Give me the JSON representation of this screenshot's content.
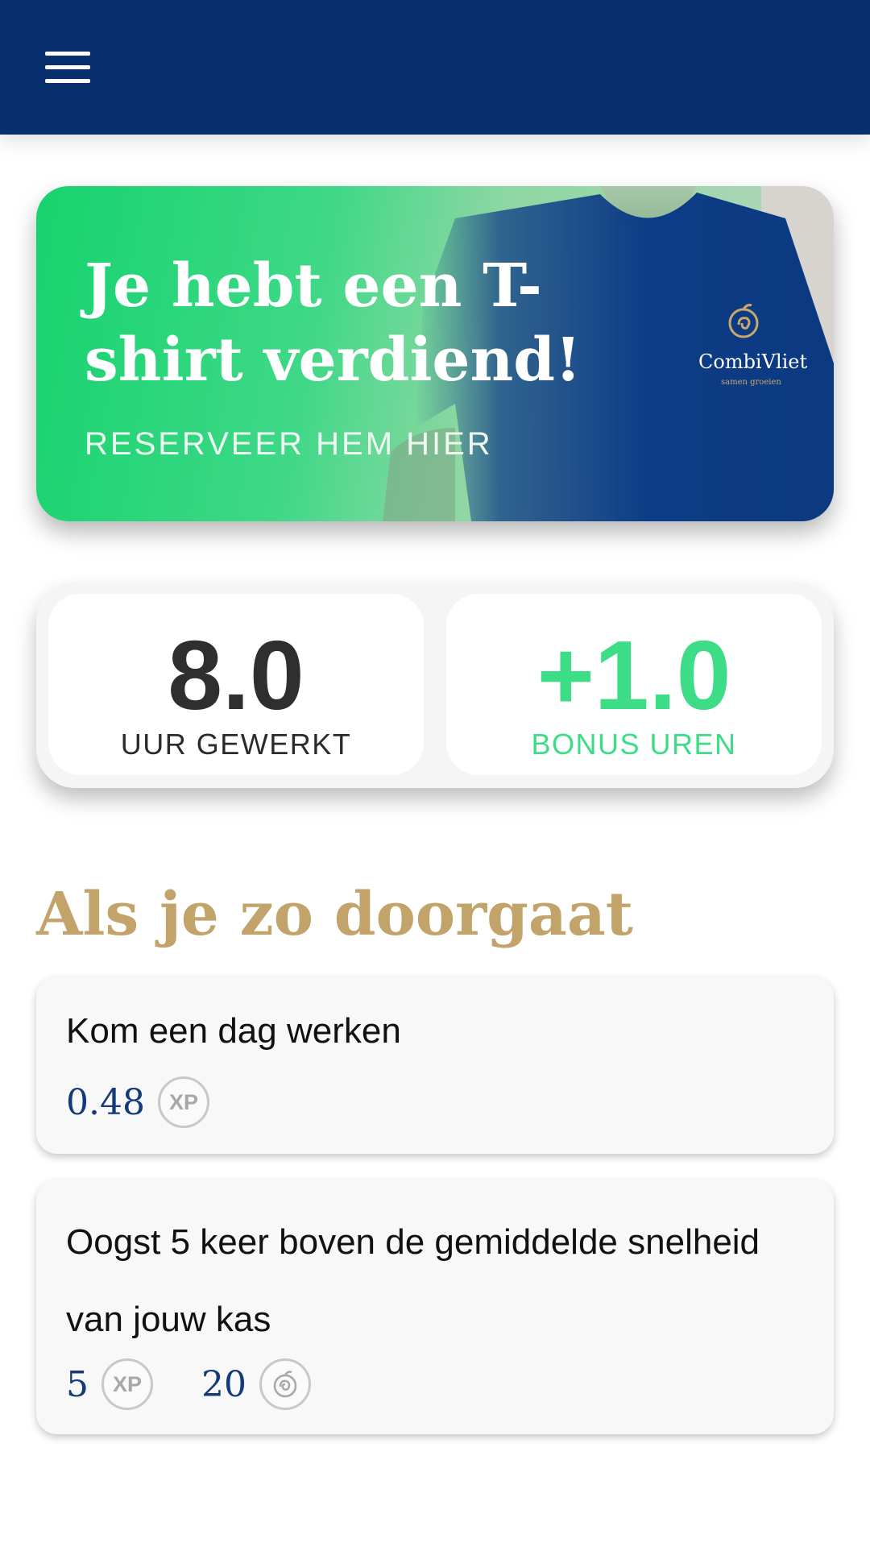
{
  "header": {
    "menu_icon": "hamburger-menu-icon",
    "background": "#08306e"
  },
  "banner": {
    "title": "Je hebt een T-shirt verdiend!",
    "subtitle": "RESERVEER HEM HIER",
    "shirt_logo_text": "CombiVliet",
    "shirt_logo_tagline": "samen groeien"
  },
  "stats": {
    "worked": {
      "value": "8.0",
      "label": "UUR GEWERKT"
    },
    "bonus": {
      "value": "+1.0",
      "label": "BONUS UREN",
      "color": "#3ddc86"
    }
  },
  "section": {
    "title": "Als je zo doorgaat",
    "color": "#c2a36a"
  },
  "tasks": [
    {
      "title": "Kom een dag werken",
      "rewards": [
        {
          "value": "0.48",
          "badge": "XP"
        }
      ]
    },
    {
      "title": "Oogst 5 keer boven de gemiddelde snelheid van jouw kas",
      "rewards": [
        {
          "value": "5",
          "badge": "XP"
        },
        {
          "value": "20",
          "badge": "spiral-coin-icon"
        }
      ]
    }
  ]
}
